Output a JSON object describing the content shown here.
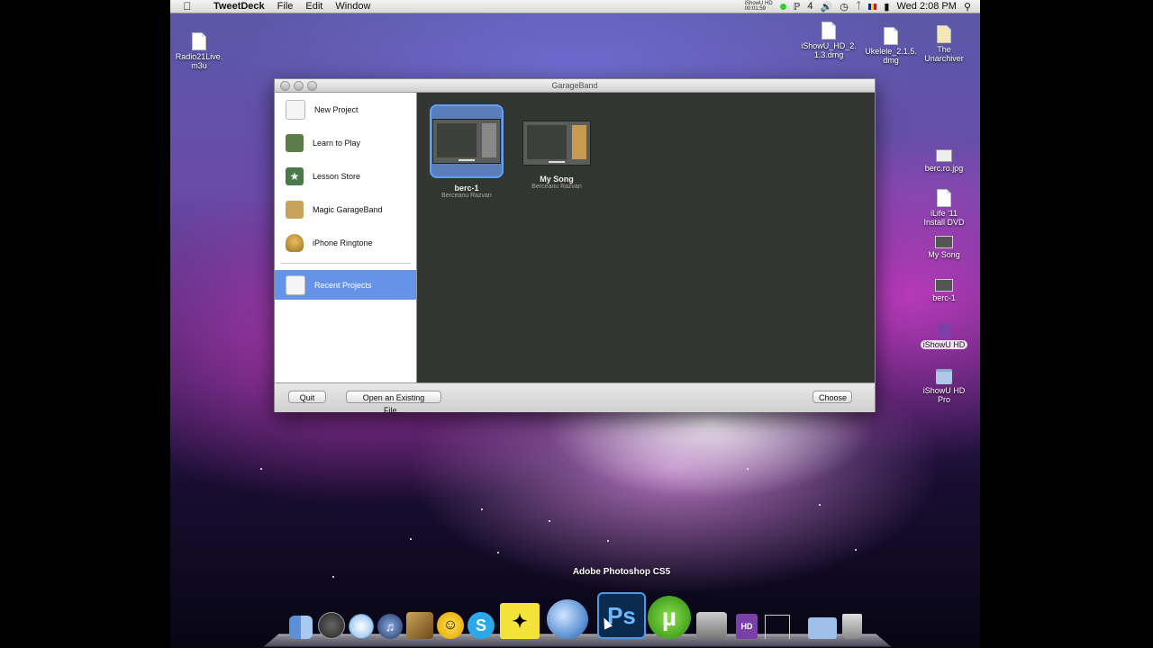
{
  "menubar": {
    "app_name": "TweetDeck",
    "menus": [
      "File",
      "Edit",
      "Window"
    ],
    "recorder_line1": "iShowU HD",
    "recorder_line2": "00:01:59",
    "wifi_label": "4",
    "clock": "Wed 2:08 PM"
  },
  "desktop_icons": {
    "radio": "Radio21Live.\nm3u",
    "ishowu_dmg": "iShowU_HD_2.\n1.3.dmg",
    "ukelele": "Ukelele_2.1.5.\ndmg",
    "unarchiver": "The\nUnarchiver",
    "berc_jpg": "berc.ro.jpg",
    "ilife": "iLife '11\nInstall DVD",
    "my_song": "My Song",
    "berc1": "berc-1",
    "ishowu_hd": "iShowU HD",
    "ishowu_pro": "iShowU HD\nPro"
  },
  "window": {
    "title": "GarageBand",
    "sidebar": {
      "items": [
        {
          "label": "New Project",
          "icon": "guitar-doc-icon"
        },
        {
          "label": "Learn to Play",
          "icon": "learn-to-play-icon"
        },
        {
          "label": "Lesson Store",
          "icon": "lesson-store-icon"
        },
        {
          "label": "Magic GarageBand",
          "icon": "magic-garageband-icon"
        },
        {
          "label": "iPhone Ringtone",
          "icon": "bell-icon"
        }
      ],
      "recent": {
        "label": "Recent Projects",
        "icon": "guitar-doc-icon"
      }
    },
    "projects": [
      {
        "name": "berc-1",
        "author": "Berceanu Razvan",
        "selected": true
      },
      {
        "name": "My Song",
        "author": "Berceanu Razvan",
        "selected": false
      }
    ],
    "buttons": {
      "quit": "Quit",
      "open": "Open an Existing File...",
      "choose": "Choose"
    }
  },
  "dock": {
    "hover_label": "Adobe Photoshop CS5",
    "ps_text": "Ps",
    "hd_text": "HD"
  },
  "colors": {
    "selection": "#6493e8",
    "content_bg": "#323531"
  }
}
